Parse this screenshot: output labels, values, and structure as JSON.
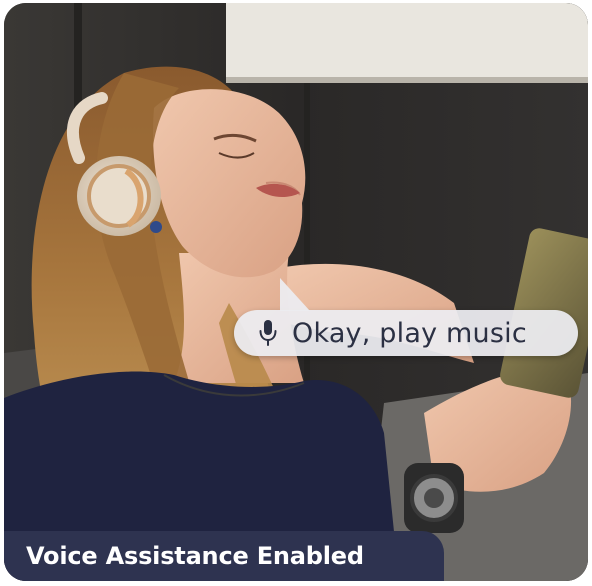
{
  "speech_bubble": {
    "icon": "microphone-icon",
    "text": "Okay, play music"
  },
  "banner": {
    "text": "Voice Assistance Enabled"
  },
  "colors": {
    "banner_bg": "#2e3350",
    "bubble_bg": "#ececf0",
    "bubble_text": "#2b3043"
  }
}
